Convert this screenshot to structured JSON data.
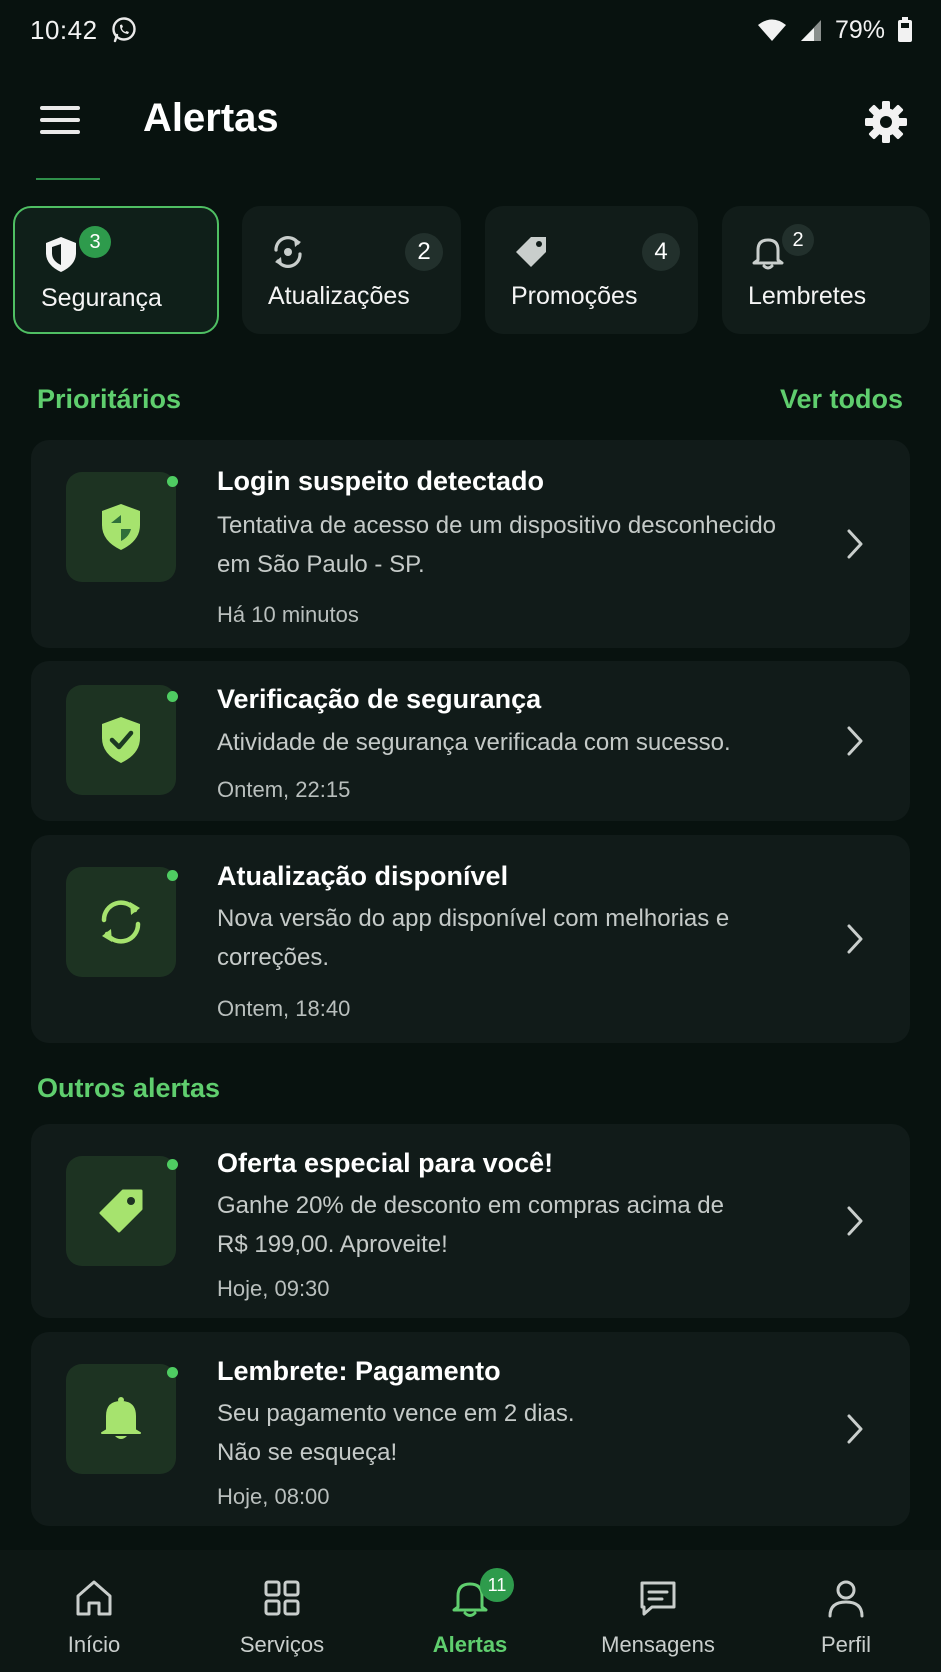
{
  "status_bar": {
    "time": "10:42",
    "battery": "79%"
  },
  "header": {
    "title": "Alertas"
  },
  "categories": [
    {
      "label": "Segurança",
      "count": "3",
      "icon": "shield-icon",
      "active": true
    },
    {
      "label": "Atualizações",
      "count": "2",
      "icon": "sync-icon",
      "active": false
    },
    {
      "label": "Promoções",
      "count": "4",
      "icon": "tag-icon",
      "active": false
    },
    {
      "label": "Lembretes",
      "count": "2",
      "icon": "bell-icon",
      "active": false
    }
  ],
  "priority": {
    "title": "Prioritários",
    "see_all": "Ver todos",
    "items": [
      {
        "title": "Login suspeito detectado",
        "description": "Tentativa de acesso de um dispositivo desconhecido em São Paulo - SP.",
        "time": "Há 10 minutos",
        "icon": "shield-icon"
      },
      {
        "title": "Verificação de segurança",
        "description": "Atividade de segurança verificada com sucesso.",
        "time": "Ontem, 22:15",
        "icon": "shield-check-icon"
      },
      {
        "title": "Atualização disponível",
        "description": "Nova versão do app disponível com melhorias e correções.",
        "time": "Ontem, 18:40",
        "icon": "sync-icon"
      }
    ]
  },
  "others": {
    "title": "Outros alertas",
    "items": [
      {
        "title": "Oferta especial para você!",
        "description": "Ganhe 20% de desconto em compras acima de R$ 199,00. Aproveite!",
        "time": "Hoje, 09:30",
        "icon": "tag-icon"
      },
      {
        "title": "Lembrete: Pagamento",
        "description": "Seu pagamento vence em 2 dias. Não se esqueça!",
        "time": "Hoje, 08:00",
        "icon": "bell-icon"
      }
    ]
  },
  "bottom_nav": [
    {
      "label": "Início",
      "icon": "home-icon"
    },
    {
      "label": "Serviços",
      "icon": "grid-icon"
    },
    {
      "label": "Alertas",
      "icon": "bell-icon",
      "badge": "11",
      "active": true
    },
    {
      "label": "Mensagens",
      "icon": "message-icon"
    },
    {
      "label": "Perfil",
      "icon": "user-icon"
    }
  ],
  "colors": {
    "accent": "#5fce6e",
    "background": "#08120f",
    "card": "#111b19",
    "badge": "#2e9b4c"
  }
}
